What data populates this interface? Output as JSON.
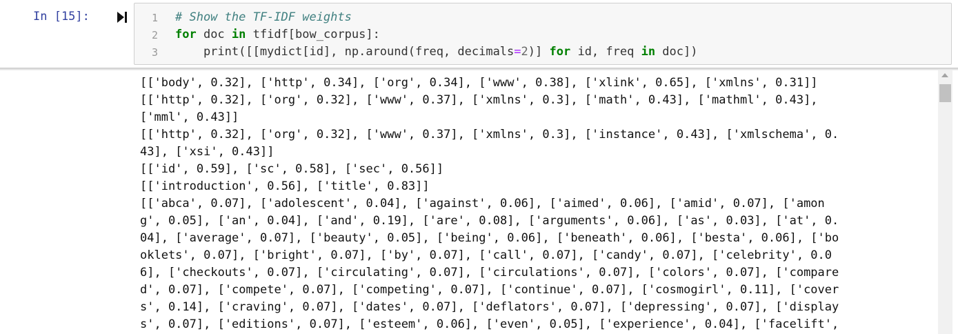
{
  "cell": {
    "prompt": "In [15]:",
    "line_numbers": [
      "1",
      "2",
      "3"
    ],
    "code": {
      "line1_comment": "# Show the TF-IDF weights",
      "line2": {
        "kw_for": "for",
        "t1": " doc ",
        "kw_in": "in",
        "t2": " tfidf[bow_corpus]:"
      },
      "line3": {
        "t1": "    print([[mydict[id], np.around(freq, decimals",
        "eq": "=",
        "num": "2",
        "t2": ")] ",
        "kw_for": "for",
        "t3": " id, freq ",
        "kw_in": "in",
        "t4": " doc])"
      }
    }
  },
  "output": {
    "lines": [
      "[['body', 0.32], ['http', 0.34], ['org', 0.34], ['www', 0.38], ['xlink', 0.65], ['xmlns', 0.31]]",
      "[['http', 0.32], ['org', 0.32], ['www', 0.37], ['xmlns', 0.3], ['math', 0.43], ['mathml', 0.43],",
      "['mml', 0.43]]",
      "[['http', 0.32], ['org', 0.32], ['www', 0.37], ['xmlns', 0.3], ['instance', 0.43], ['xmlschema', 0.",
      "43], ['xsi', 0.43]]",
      "[['id', 0.59], ['sc', 0.58], ['sec', 0.56]]",
      "[['introduction', 0.56], ['title', 0.83]]",
      "[['abca', 0.07], ['adolescent', 0.04], ['against', 0.06], ['aimed', 0.06], ['amid', 0.07], ['amon",
      "g', 0.05], ['an', 0.04], ['and', 0.19], ['are', 0.08], ['arguments', 0.06], ['as', 0.03], ['at', 0.",
      "04], ['average', 0.07], ['beauty', 0.05], ['being', 0.06], ['beneath', 0.06], ['besta', 0.06], ['bo",
      "oklets', 0.07], ['bright', 0.07], ['by', 0.07], ['call', 0.07], ['candy', 0.07], ['celebrity', 0.0",
      "6], ['checkouts', 0.07], ['circulating', 0.07], ['circulations', 0.07], ['colors', 0.07], ['compare",
      "d', 0.07], ['compete', 0.07], ['competing', 0.07], ['continue', 0.07], ['cosmogirl', 0.11], ['cover",
      "s', 0.14], ['craving', 0.07], ['dates', 0.07], ['deflators', 0.07], ['depressing', 0.07], ['display",
      "s', 0.07], ['editions', 0.07], ['esteem', 0.06], ['even', 0.05], ['experience', 0.04], ['facelift',"
    ]
  },
  "icons": {
    "run": "run-cell-icon",
    "scroll_up": "scroll-up-arrow-icon"
  },
  "colors": {
    "prompt": "#303f9f",
    "keyword": "#008000",
    "comment": "#408080",
    "operator": "#aa22ff",
    "number": "#666666",
    "input_background": "#f7f7f7"
  }
}
